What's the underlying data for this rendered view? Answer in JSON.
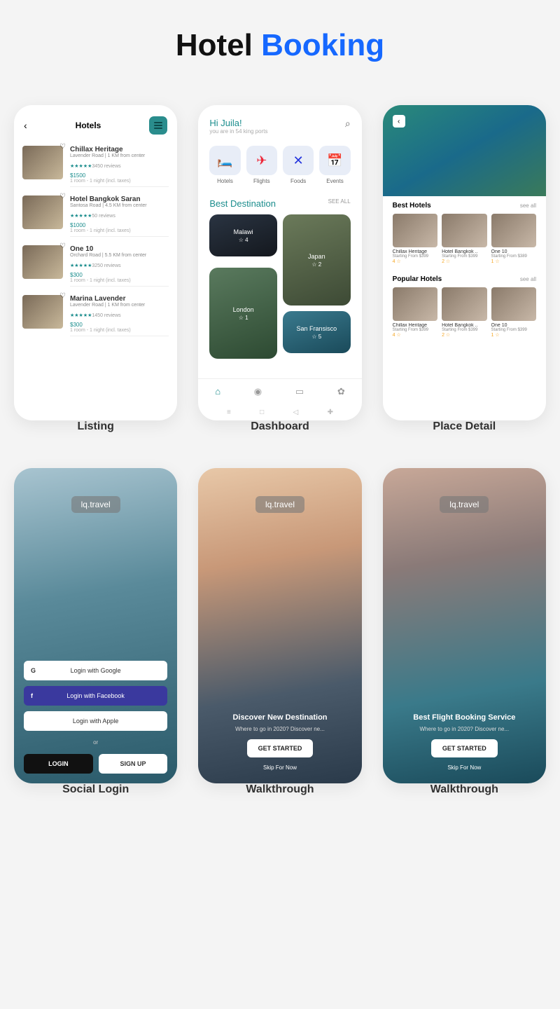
{
  "title": {
    "a": "Hotel",
    "b": "Booking"
  },
  "labels": [
    "Listing",
    "Dashboard",
    "Place Detail",
    "Social Login",
    "Walkthrough",
    "Walkthrough"
  ],
  "listing": {
    "title": "Hotels",
    "items": [
      {
        "name": "Chillax Heritage",
        "sub": "Lavender Road | 1 KM from center",
        "reviews": "3450 reviews",
        "price": "$1500",
        "meta": "1 room - 1 night (incl. taxes)"
      },
      {
        "name": "Hotel Bangkok Saran",
        "sub": "Santosa Road | 4.5 KM from center",
        "reviews": "50 reviews",
        "price": "$1000",
        "meta": "1 room - 1 night (incl. taxes)"
      },
      {
        "name": "One 10",
        "sub": "Orchard Road | 5.5 KM from center",
        "reviews": "3250 reviews",
        "price": "$300",
        "meta": "1 room - 1 night (incl. taxes)"
      },
      {
        "name": "Marina Lavender",
        "sub": "Lavender Road | 1 KM from center",
        "reviews": "1450 reviews",
        "price": "$300",
        "meta": "1 room - 1 night (incl. taxes)"
      }
    ]
  },
  "dashboard": {
    "greet": "Hi Juila!",
    "greet_sub": "you are in 54 king ports",
    "cats": [
      {
        "icon": "🛏️",
        "label": "Hotels"
      },
      {
        "icon": "✈",
        "label": "Flights",
        "color": "#e23"
      },
      {
        "icon": "✕",
        "label": "Foods",
        "color": "#23d"
      },
      {
        "icon": "📅",
        "label": "Events",
        "color": "#f90"
      }
    ],
    "sec_title": "Best Destination",
    "sec_all": "SEE ALL",
    "dests": [
      {
        "n": "Malawi",
        "r": "☆ 4"
      },
      {
        "n": "Japan",
        "r": "☆ 2"
      },
      {
        "n": "London",
        "r": "☆ 1"
      },
      {
        "n": "San Fransisco",
        "r": "☆ 5"
      }
    ]
  },
  "place": {
    "sections": [
      {
        "t": "Best Hotels",
        "all": "see all",
        "cards": [
          {
            "n": "Chillax Heritage",
            "p": "Starting From $399",
            "s": "4 ☆"
          },
          {
            "n": "Hotel Bangkok ..",
            "p": "Starting From $399",
            "s": "2 ☆"
          },
          {
            "n": "One 10",
            "p": "Starting From $389",
            "s": "1 ☆"
          }
        ]
      },
      {
        "t": "Popular Hotels",
        "all": "see all",
        "cards": [
          {
            "n": "Chillax Heritage",
            "p": "Starting From $399",
            "s": "4 ☆"
          },
          {
            "n": "Hotel Bangkok ..",
            "p": "Starting From $399",
            "s": "2 ☆"
          },
          {
            "n": "One 10",
            "p": "Starting From $399",
            "s": "1 ☆"
          }
        ]
      }
    ]
  },
  "login": {
    "logo": "lq.travel",
    "google": "Login with Google",
    "fb": "Login with Facebook",
    "apple": "Login with Apple",
    "or": "or",
    "login": "LOGIN",
    "signup": "SIGN UP"
  },
  "walk1": {
    "logo": "lq.travel",
    "t": "Discover New Destination",
    "s": "Where to go in 2020? Discover ne...",
    "btn": "GET STARTED",
    "skip": "Skip For Now"
  },
  "walk2": {
    "logo": "lq.travel",
    "t": "Best Flight Booking Service",
    "s": "Where to go in 2020? Discover ne...",
    "btn": "GET STARTED",
    "skip": "Skip For Now"
  }
}
